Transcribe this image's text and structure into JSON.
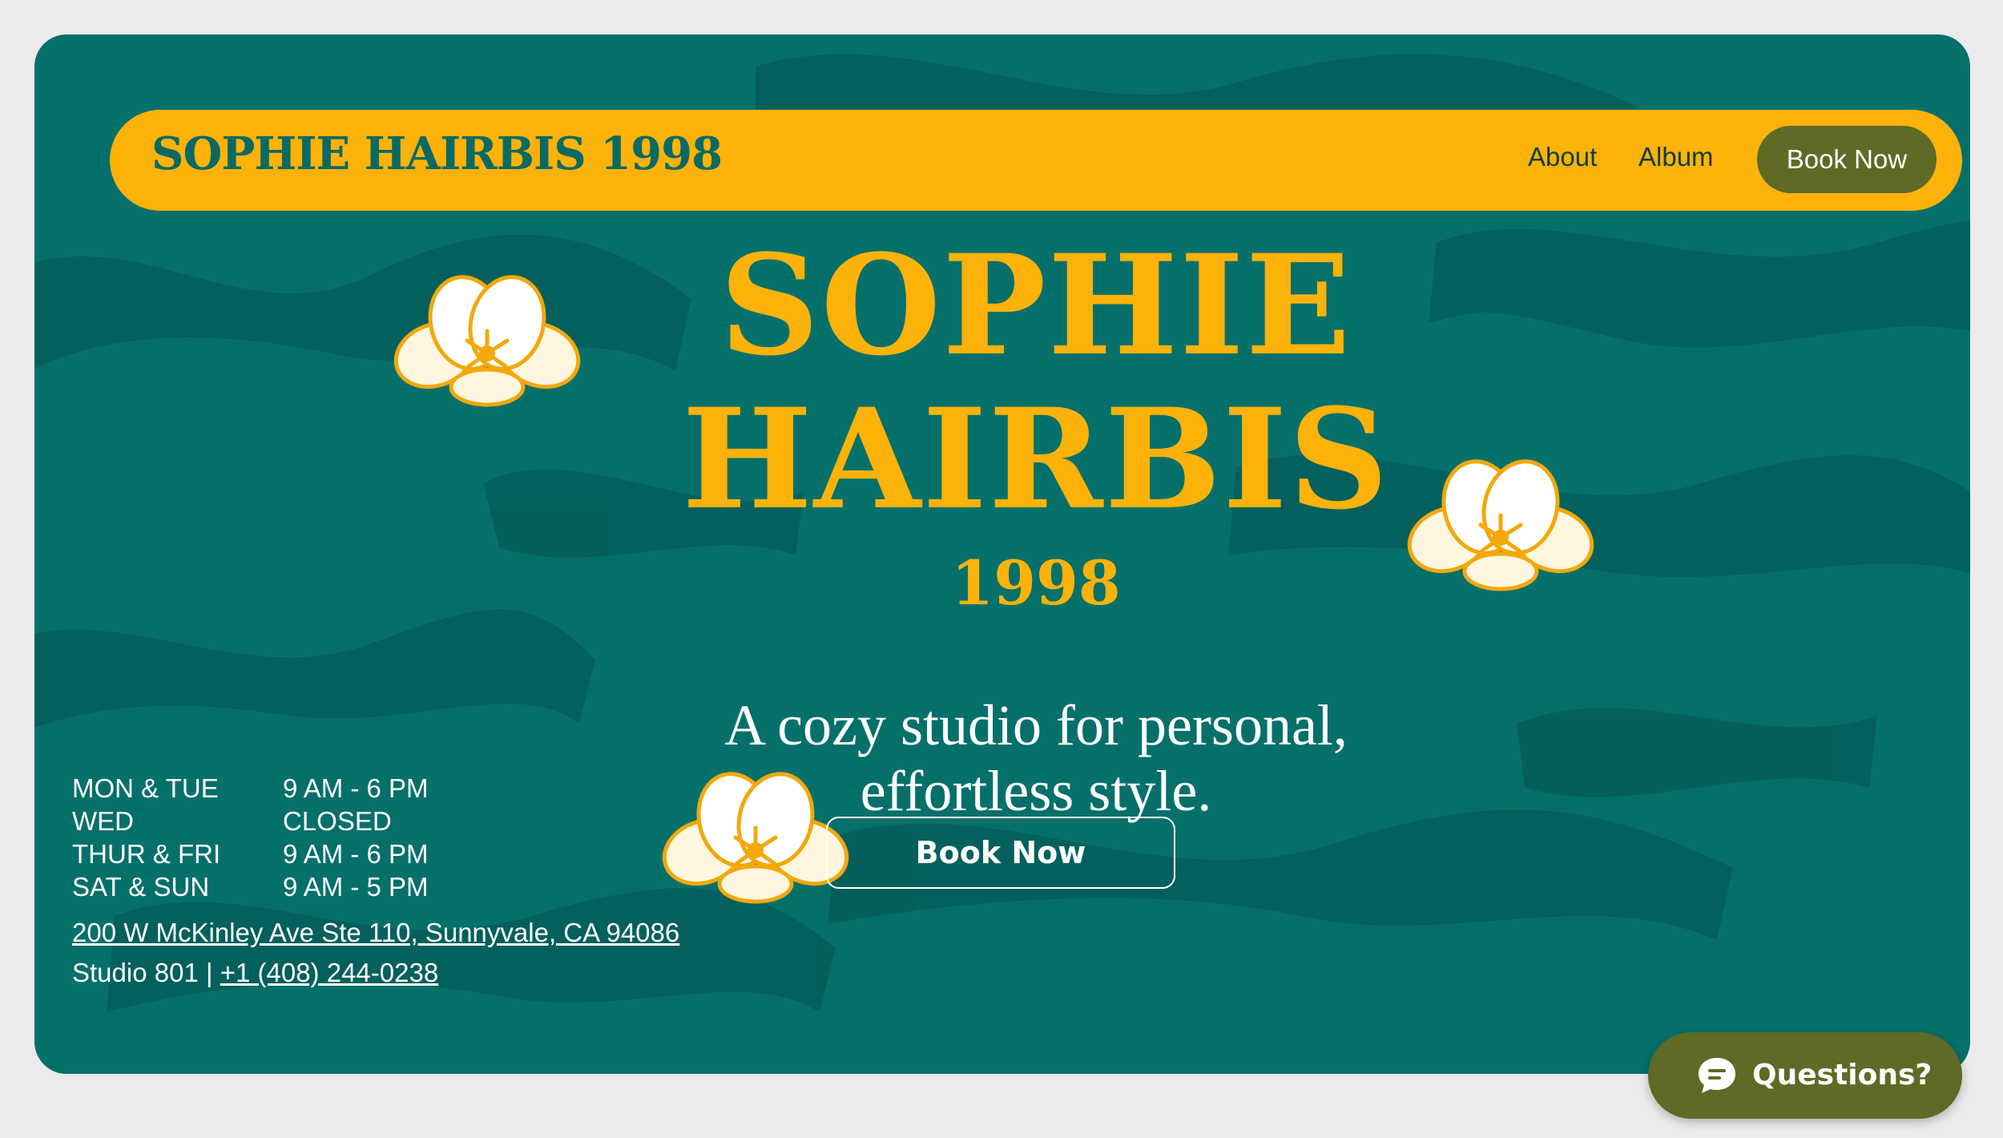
{
  "nav": {
    "brand": "SOPHIE HAIRBIS 1998",
    "links": [
      "About",
      "Album"
    ],
    "book_label": "Book Now"
  },
  "hero": {
    "headline_line1": "SOPHIE",
    "headline_line2": "HAIRBIS",
    "headline_year": "1998",
    "tagline_line1": "A cozy studio for personal,",
    "tagline_line2": "effortless style.",
    "book_label": "Book Now"
  },
  "hours": [
    {
      "day": "MON & TUE",
      "time": "9 AM - 6 PM"
    },
    {
      "day": "WED",
      "time": "CLOSED"
    },
    {
      "day": "THUR & FRI",
      "time": "9 AM - 6 PM"
    },
    {
      "day": "SAT & SUN",
      "time": "9 AM - 5 PM"
    }
  ],
  "contact": {
    "address": "200 W McKinley Ave Ste 110, Sunnyvale, CA 94086",
    "studio": "Studio 801 | ",
    "phone": "+1 (408) 244-0238"
  },
  "chat_widget": {
    "label": "Questions?",
    "icon": "chat-bubble-icon"
  },
  "colors": {
    "background": "#05706a",
    "accent_yellow": "#fdb209",
    "button_olive": "#5e6a25",
    "page_bg": "#ebebeb"
  }
}
